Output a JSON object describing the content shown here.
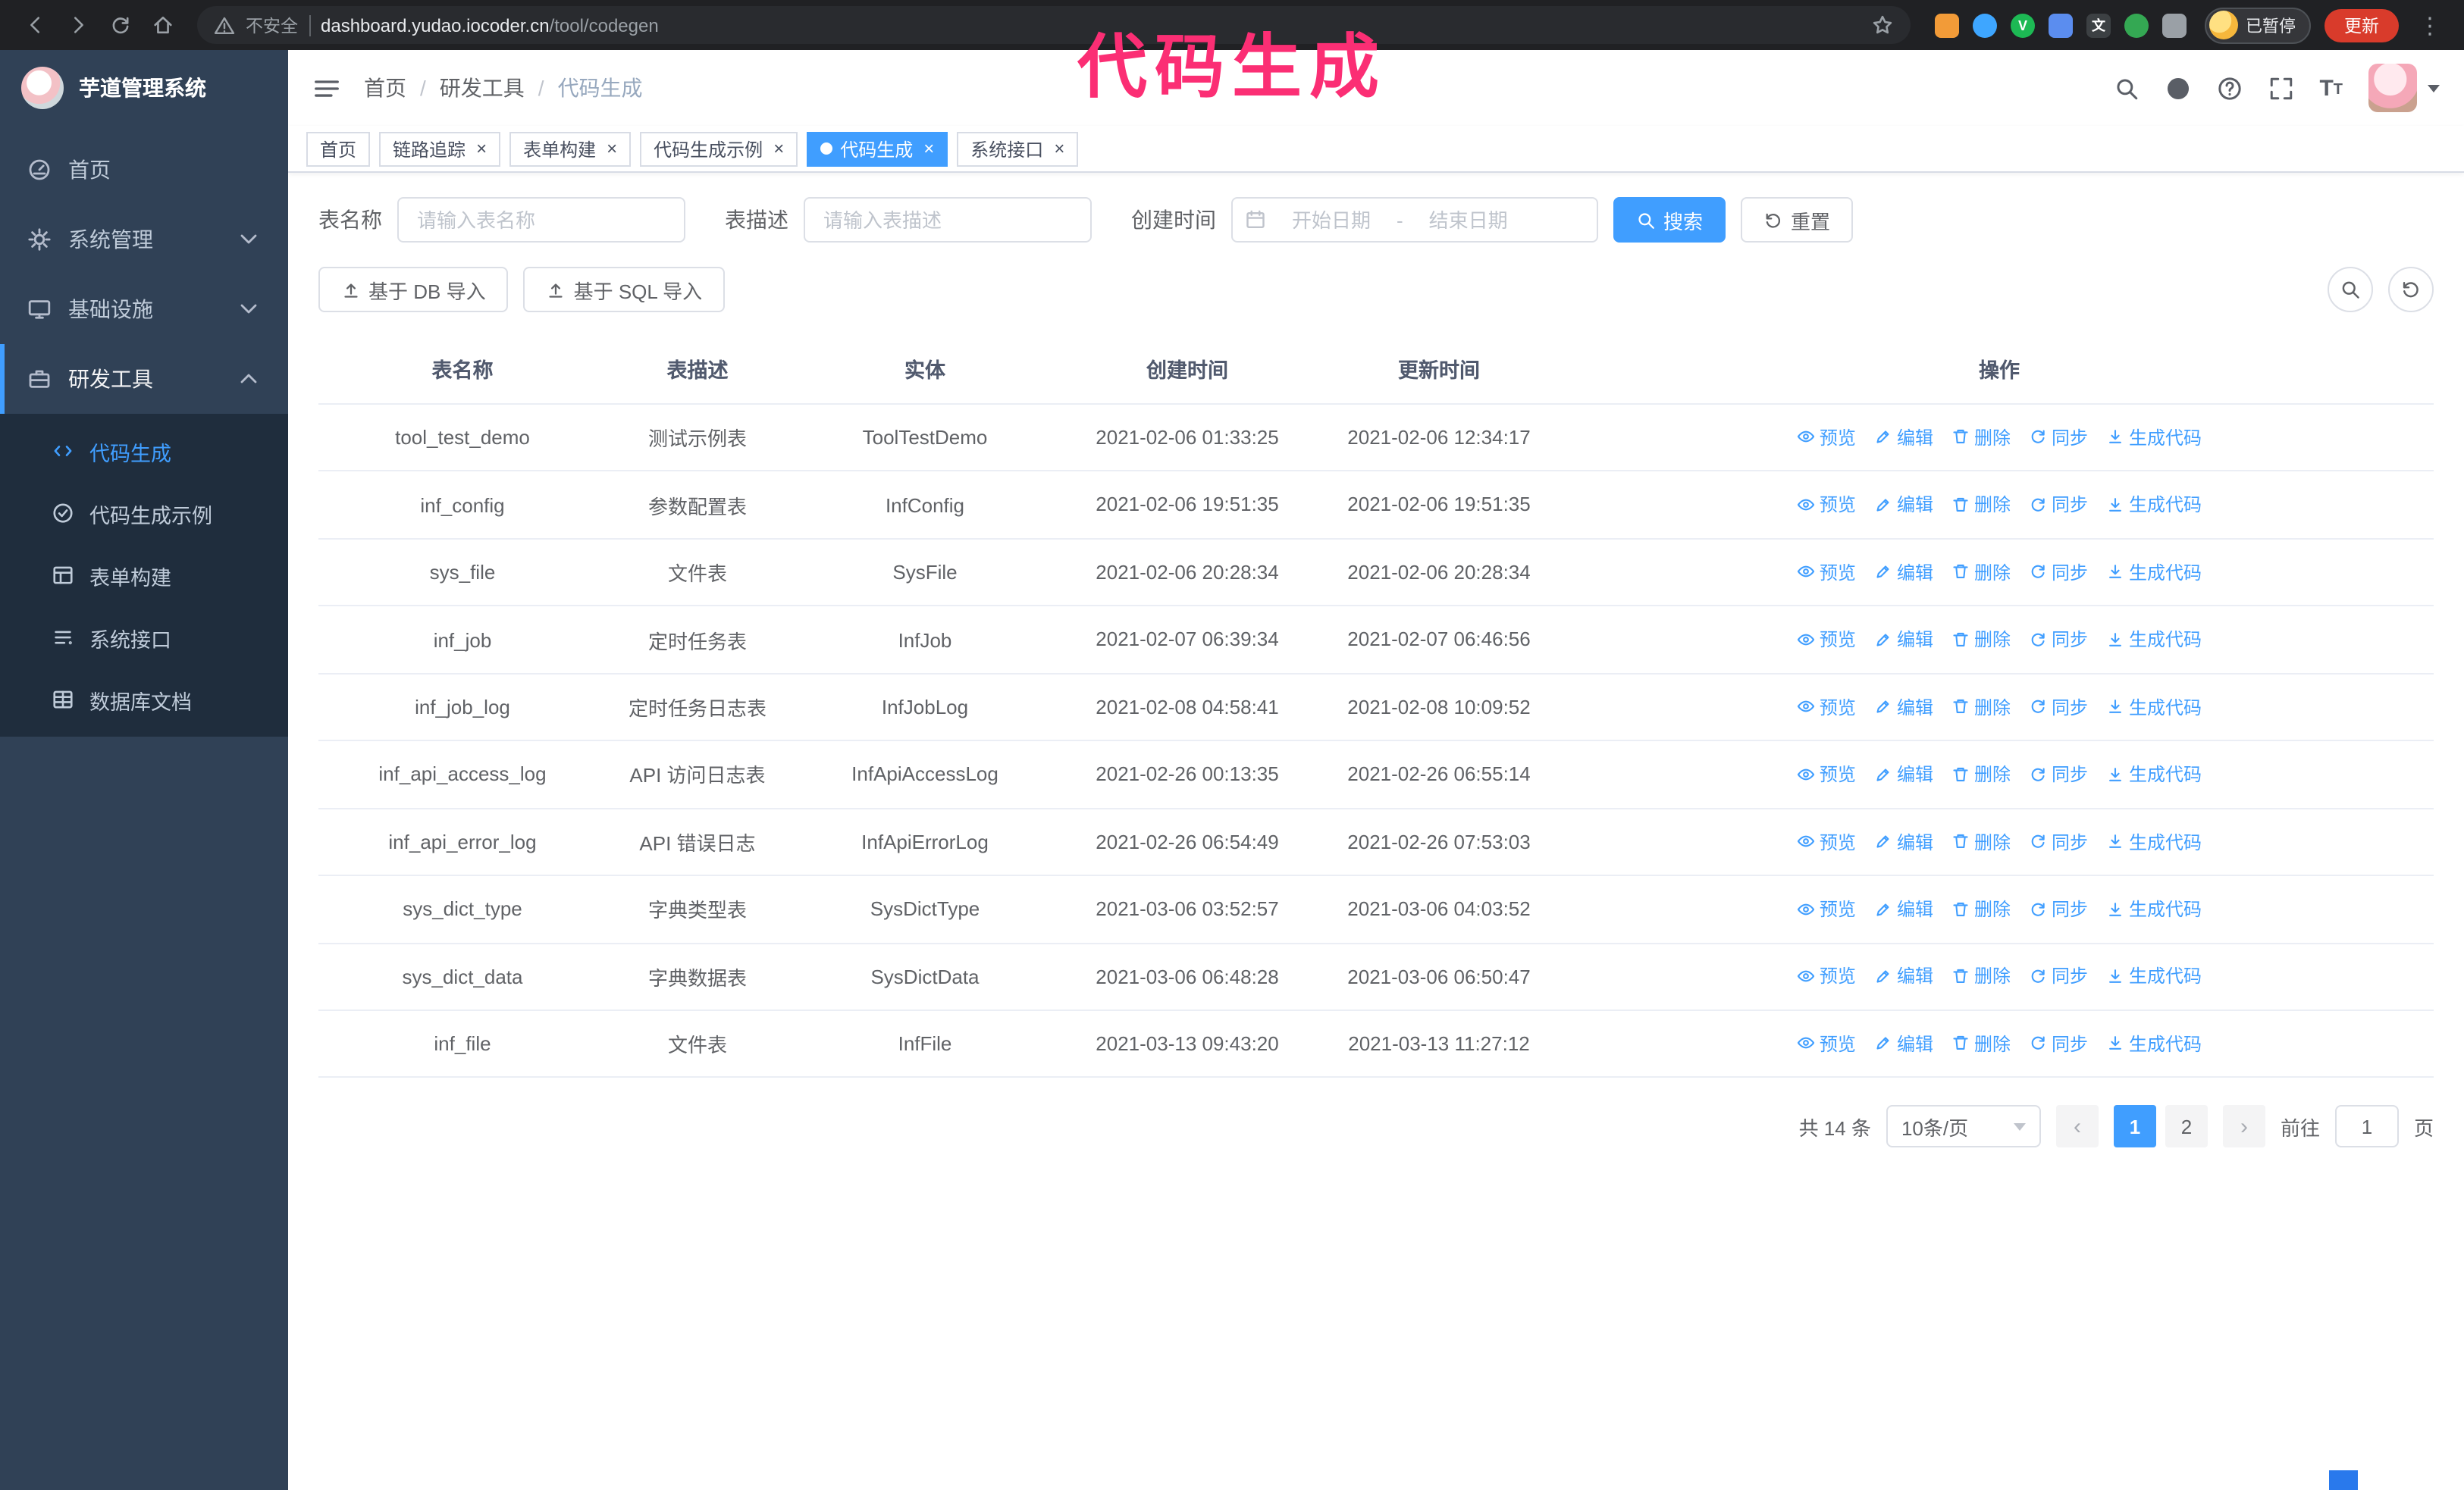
{
  "annotation": {
    "text": "代码生成",
    "color": "#fb2e74"
  },
  "browser": {
    "security_label": "不安全",
    "url_host": "dashboard.yudao.iocoder.cn",
    "url_path": "/tool/codegen",
    "extensions": [
      {
        "name": "bird",
        "color": "#f29b38",
        "shape": "square",
        "glyph": ""
      },
      {
        "name": "water-drop",
        "color": "#3ea6ff",
        "shape": "circle",
        "glyph": ""
      },
      {
        "name": "v-badge",
        "color": "#1db954",
        "shape": "circle",
        "glyph": "V"
      },
      {
        "name": "people",
        "color": "#5b8def",
        "shape": "square",
        "glyph": ""
      },
      {
        "name": "translate",
        "color": "#3c4043",
        "shape": "square",
        "glyph": "文"
      },
      {
        "name": "plant",
        "color": "#34a853",
        "shape": "circle",
        "glyph": ""
      },
      {
        "name": "puzzle",
        "color": "#9aa0a6",
        "shape": "square",
        "glyph": ""
      }
    ],
    "profile_badge": "已暂停",
    "update_button": "更新"
  },
  "sidebar": {
    "logo_title": "芋道管理系统",
    "menu": [
      {
        "key": "home",
        "label": "首页",
        "icon": "dashboard"
      },
      {
        "key": "system",
        "label": "系统管理",
        "icon": "gear",
        "chevron": "down"
      },
      {
        "key": "infra",
        "label": "基础设施",
        "icon": "monitor",
        "chevron": "down"
      },
      {
        "key": "dev-tools",
        "label": "研发工具",
        "icon": "tool",
        "chevron": "up",
        "expanded": true,
        "children": [
          {
            "key": "codegen",
            "label": "代码生成",
            "icon": "code",
            "active": true
          },
          {
            "key": "codegen-example",
            "label": "代码生成示例",
            "icon": "badge",
            "active": false
          },
          {
            "key": "form-builder",
            "label": "表单构建",
            "icon": "form",
            "active": false
          },
          {
            "key": "api",
            "label": "系统接口",
            "icon": "api",
            "active": false
          },
          {
            "key": "db-doc",
            "label": "数据库文档",
            "icon": "database",
            "active": false
          }
        ]
      }
    ]
  },
  "header": {
    "breadcrumb": [
      "首页",
      "研发工具",
      "代码生成"
    ]
  },
  "tabs": [
    {
      "key": "home",
      "label": "首页",
      "closable": false,
      "active": false
    },
    {
      "key": "tracing",
      "label": "链路追踪",
      "closable": true,
      "active": false
    },
    {
      "key": "form-builder",
      "label": "表单构建",
      "closable": true,
      "active": false
    },
    {
      "key": "codegen-example",
      "label": "代码生成示例",
      "closable": true,
      "active": false
    },
    {
      "key": "codegen",
      "label": "代码生成",
      "closable": true,
      "active": true
    },
    {
      "key": "api",
      "label": "系统接口",
      "closable": true,
      "active": false
    }
  ],
  "filters": {
    "table_name_label": "表名称",
    "table_name_placeholder": "请输入表名称",
    "table_desc_label": "表描述",
    "table_desc_placeholder": "请输入表描述",
    "create_time_label": "创建时间",
    "date_start_placeholder": "开始日期",
    "date_separator": "-",
    "date_end_placeholder": "结束日期",
    "search_button": "搜索",
    "reset_button": "重置"
  },
  "toolbar": {
    "import_db": "基于 DB 导入",
    "import_sql": "基于 SQL 导入"
  },
  "table": {
    "columns": [
      "表名称",
      "表描述",
      "实体",
      "创建时间",
      "更新时间",
      "操作"
    ],
    "actions": [
      "预览",
      "编辑",
      "删除",
      "同步",
      "生成代码"
    ],
    "rows": [
      {
        "name": "tool_test_demo",
        "desc": "测试示例表",
        "entity": "ToolTestDemo",
        "created": "2021-02-06 01:33:25",
        "updated": "2021-02-06 12:34:17"
      },
      {
        "name": "inf_config",
        "desc": "参数配置表",
        "entity": "InfConfig",
        "created": "2021-02-06 19:51:35",
        "updated": "2021-02-06 19:51:35"
      },
      {
        "name": "sys_file",
        "desc": "文件表",
        "entity": "SysFile",
        "created": "2021-02-06 20:28:34",
        "updated": "2021-02-06 20:28:34"
      },
      {
        "name": "inf_job",
        "desc": "定时任务表",
        "entity": "InfJob",
        "created": "2021-02-07 06:39:34",
        "updated": "2021-02-07 06:46:56"
      },
      {
        "name": "inf_job_log",
        "desc": "定时任务日志表",
        "entity": "InfJobLog",
        "created": "2021-02-08 04:58:41",
        "updated": "2021-02-08 10:09:52"
      },
      {
        "name": "inf_api_access_log",
        "desc": "API 访问日志表",
        "entity": "InfApiAccessLog",
        "created": "2021-02-26 00:13:35",
        "updated": "2021-02-26 06:55:14"
      },
      {
        "name": "inf_api_error_log",
        "desc": "API 错误日志",
        "entity": "InfApiErrorLog",
        "created": "2021-02-26 06:54:49",
        "updated": "2021-02-26 07:53:03"
      },
      {
        "name": "sys_dict_type",
        "desc": "字典类型表",
        "entity": "SysDictType",
        "created": "2021-03-06 03:52:57",
        "updated": "2021-03-06 04:03:52"
      },
      {
        "name": "sys_dict_data",
        "desc": "字典数据表",
        "entity": "SysDictData",
        "created": "2021-03-06 06:48:28",
        "updated": "2021-03-06 06:50:47"
      },
      {
        "name": "inf_file",
        "desc": "文件表",
        "entity": "InfFile",
        "created": "2021-03-13 09:43:20",
        "updated": "2021-03-13 11:27:12"
      }
    ]
  },
  "pagination": {
    "total": "共 14 条",
    "page_size": "10条/页",
    "pages": [
      "1",
      "2"
    ],
    "active_page": "1",
    "goto_label": "前往",
    "goto_value": "1",
    "goto_suffix": "页"
  },
  "colors": {
    "accent": "#409eff",
    "sidebar_bg": "#304156",
    "submenu_bg": "#1f2d3d",
    "annotation": "#fb2e74",
    "update_button": "#d93b2b"
  }
}
